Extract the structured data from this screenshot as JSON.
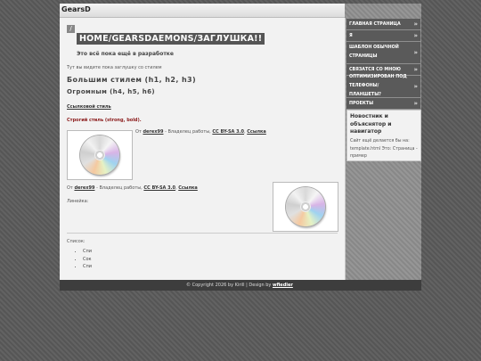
{
  "site": {
    "title": "GearsD"
  },
  "main": {
    "breadcrumb_icon": "/",
    "title": "HOME/GEARSDAEMONS/ЗАГЛУШКА!!",
    "subtitle": "Это всё пока ещё в разработке",
    "intro": "Тут вы видите пока заглушку со стилем",
    "heading_big": "Большим стилем (h1, h2, h3)",
    "heading_medium": "Огромным (h4, h5, h6)",
    "link_text": "Ссылковой стиль",
    "strong_text": "Строгий стиль (strong, bold).",
    "credit1": {
      "prefix": "От",
      "author": "derex99",
      "middle": "- Владелец работы,",
      "license": "CC BY-SA 3.0",
      "sep": ",",
      "link": "Ссылка"
    },
    "credit2": {
      "prefix": "От",
      "author": "derex99",
      "middle": "- Владелец работы,",
      "license": "CC BY-SA 3.0",
      "sep": ",",
      "link": "Ссылка"
    },
    "line_label": "Линейка:",
    "list_label": "Список:",
    "list_items": [
      "Спи",
      "Сок",
      "Спи"
    ]
  },
  "footer": {
    "text": "© Copyright 2026 by Kirill | Design by",
    "designer": "wfiedler"
  },
  "menu": {
    "items": [
      {
        "label": "ГЛАВНАЯ СТРАНИЦА",
        "arrow": "»"
      },
      {
        "label": "Я",
        "arrow": "»"
      },
      {
        "label": "ШАБЛОН ОБЫЧНОЙ СТРАНИЦЫ",
        "arrow": "»"
      },
      {
        "label": "СВЯЗАТСЯ СО МНОЮ",
        "arrow": "»"
      },
      {
        "label": "ОПТИМИЗИРОВАН ПОД ТЕЛЕФОНЫ/ПЛАНШЕТЫ?",
        "arrow": "»"
      },
      {
        "label": "ПРОЕКТЫ",
        "arrow": "»"
      }
    ]
  },
  "sidebar": {
    "box_title": "Новостник и объяснятор и навигатор",
    "box_text": "Сайт ещё делается бы на: template.html Это: Страница - пример"
  },
  "colors": {
    "menu_bg": "#5a5a5a",
    "strong_text": "#8b1a1a",
    "title_bg": "#555555"
  }
}
